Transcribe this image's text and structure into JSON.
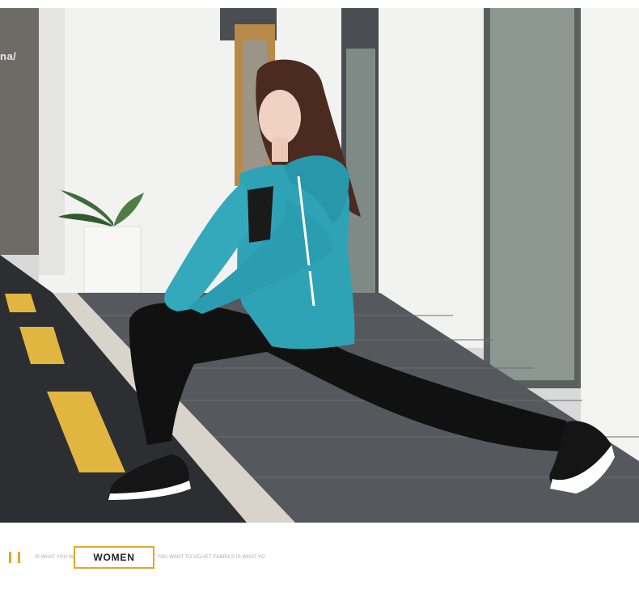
{
  "photo": {
    "watermark_text": "na/",
    "colors": {
      "jacket": "#2fa3b6",
      "pants": "#111111",
      "road": "#2d2e31",
      "lane_marking": "#e1b640",
      "wall": "#f2f2f0"
    }
  },
  "caption": {
    "accent_color": "#e1a828",
    "tagline": "IS WHAT YOU WANT TO VELVET FABRICS IS WHAT YOU WANT TO VELVET FABRICS IS WHAT YO",
    "highlight_word": "WOMEN"
  }
}
